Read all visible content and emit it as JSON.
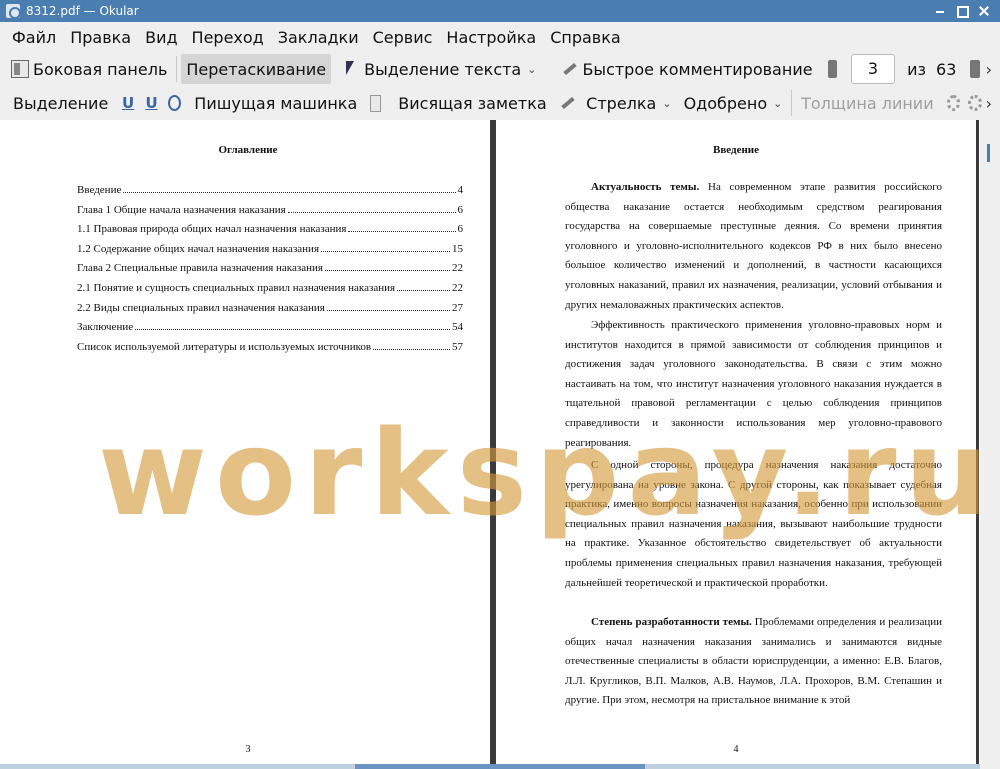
{
  "window": {
    "title": "8312.pdf — Okular"
  },
  "menu": [
    "Файл",
    "Правка",
    "Вид",
    "Переход",
    "Закладки",
    "Сервис",
    "Настройка",
    "Справка"
  ],
  "toolbar1": {
    "sidebar": "Боковая панель",
    "drag": "Перетаскивание",
    "text_select": "Выделение текста",
    "quick_comment": "Быстрое комментирование",
    "page_current": "3",
    "page_of": "из",
    "page_total": "63"
  },
  "toolbar2": {
    "selection": "Выделение",
    "typewriter": "Пишущая машинка",
    "hanging_note": "Висящая заметка",
    "arrow": "Стрелка",
    "approved": "Одобрено",
    "line_width": "Толщина линии"
  },
  "left_page": {
    "heading": "Оглавление",
    "toc": [
      {
        "label": "Введение",
        "page": "4"
      },
      {
        "label": "Глава 1 Общие начала назначения наказания",
        "page": "6"
      },
      {
        "label": "1.1 Правовая природа общих начал назначения наказания",
        "page": "6"
      },
      {
        "label": "1.2 Содержание общих начал назначения наказания",
        "page": "15"
      },
      {
        "label": "Глава 2 Специальные правила назначения наказания",
        "page": "22"
      },
      {
        "label": "2.1 Понятие и сущность специальных правил назначения наказания",
        "page": "22"
      },
      {
        "label": "2.2 Виды специальных правил назначения наказания",
        "page": "27"
      },
      {
        "label": "Заключение",
        "page": "54"
      },
      {
        "label": "Список используемой литературы и используемых источников",
        "page": "57"
      }
    ],
    "page_number": "3"
  },
  "right_page": {
    "heading": "Введение",
    "p1_bold": "Актуальность темы.",
    "p1": "На современном этапе развития российского общества наказание остается необходимым средством реагирования государства на совершаемые преступные деяния. Со времени принятия уголовного и уголовно-исполнительного кодексов РФ в них было внесено большое количество изменений и дополнений, в частности касающихся уголовных наказаний, правил их назначения, реализации, условий отбывания и других немаловажных практических аспектов.",
    "p2": "Эффективность практического применения уголовно-правовых норм и институтов находится в прямой зависимости от соблюдения принципов и достижения задач уголовного законодательства. В связи с этим можно настаивать на том, что институт назначения уголовного наказания нуждается в тщательной правовой регламентации с целью соблюдения принципов справедливости и законности использования мер уголовно-правового реагирования.",
    "p3": "С одной стороны, процедура назначения наказания достаточно урегулирована на уровне закона. С другой стороны, как показывает судебная практика, именно вопросы назначения наказания, особенно при использовании специальных правил назначения наказания, вызывают наибольшие трудности на практике. Указанное обстоятельство свидетельствует об актуальности проблемы применения специальных правил назначения наказания, требующей дальнейшей теоретической и практической проработки.",
    "p4_bold": "Степень разработанности темы.",
    "p4": "Проблемами определения и реализации общих начал назначения наказания занимались и занимаются видные отечественные специалисты в области юриспруденции, а именно: Е.В. Благов, Л.Л. Кругликов, В.П. Малков, А.В. Наумов, Л.А. Прохоров, В.М. Степашин и другие. При этом, несмотря на пристальное внимание к этой",
    "page_number": "4"
  },
  "watermark": "workspay.ru"
}
